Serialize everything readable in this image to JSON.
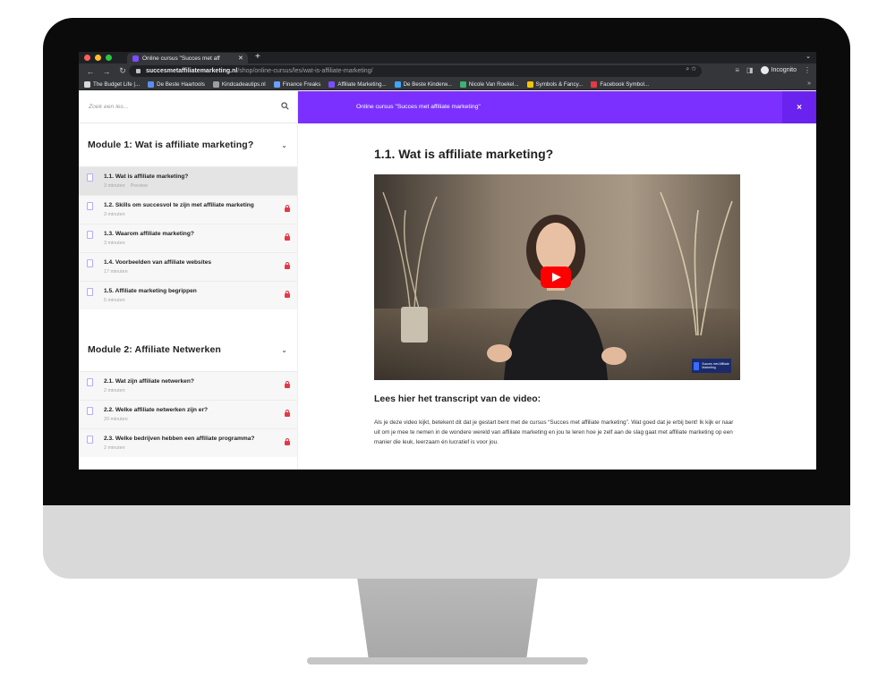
{
  "browser": {
    "tab_title": "Online cursus \"Succes met aff",
    "url_host": "succesmetaffiliatemarketing.nl",
    "url_path": "/shop/online-cursus/les/wat-is-affiliate-marketing/",
    "incognito_label": "Incognito",
    "bookmarks": [
      {
        "label": "The Budget Life |...",
        "color": "#d9d9d9"
      },
      {
        "label": "De Beste Haartools",
        "color": "#5b8def"
      },
      {
        "label": "Kindcadeautips.nl",
        "color": "#9aa0a6"
      },
      {
        "label": "Finance Freaks",
        "color": "#6aa0ff"
      },
      {
        "label": "Affiliate Marketing...",
        "color": "#7b4dff"
      },
      {
        "label": "De Beste Kinderw...",
        "color": "#3ea6ff"
      },
      {
        "label": "Nicole Van Roekel...",
        "color": "#3cb371"
      },
      {
        "label": "Symbols & Fancy...",
        "color": "#f5c400"
      },
      {
        "label": "Facebook Symbol...",
        "color": "#e53945"
      }
    ]
  },
  "sidebar": {
    "search_placeholder": "Zoek een les...",
    "modules": [
      {
        "title": "Module 1: Wat is affiliate marketing?",
        "lessons": [
          {
            "title": "1.1. Wat is affiliate marketing?",
            "duration": "3 minuten",
            "preview": "Preview",
            "locked": false,
            "active": true
          },
          {
            "title": "1.2. Skills om succesvol te zijn met affiliate marketing",
            "duration": "3 minuten",
            "preview": "",
            "locked": true,
            "active": false
          },
          {
            "title": "1.3. Waarom affiliate marketing?",
            "duration": "3 minuten",
            "preview": "",
            "locked": true,
            "active": false
          },
          {
            "title": "1.4. Voorbeelden van affiliate websites",
            "duration": "17 minuten",
            "preview": "",
            "locked": true,
            "active": false
          },
          {
            "title": "1.5. Affiliate marketing begrippen",
            "duration": "5 minuten",
            "preview": "",
            "locked": true,
            "active": false
          }
        ]
      },
      {
        "title": "Module 2: Affiliate Netwerken",
        "lessons": [
          {
            "title": "2.1. Wat zijn affiliate netwerken?",
            "duration": "2 minuten",
            "preview": "",
            "locked": true,
            "active": false
          },
          {
            "title": "2.2. Welke affiliate netwerken zijn er?",
            "duration": "20 minuten",
            "preview": "",
            "locked": true,
            "active": false
          },
          {
            "title": "2.3. Welke bedrijven hebben een affiliate programma?",
            "duration": "2 minuten",
            "preview": "",
            "locked": true,
            "active": false
          }
        ]
      }
    ]
  },
  "course_bar": {
    "title": "Online cursus \"Succes met affiliate marketing\"",
    "close_label": "×"
  },
  "content": {
    "lesson_title": "1.1. Wat is affiliate marketing?",
    "video_logo": "Succes met Affiliate Marketing",
    "transcript_heading": "Lees hier het transcript van de video:",
    "transcript_text": "Als je deze video kijkt, betekent dit dat je gestart bent met de cursus “Succes met affiliate marketing”. Wat goed dat je erbij bent! Ik kijk er naar uit om je mee te nemen in de wondere wereld van affiliate marketing en jou te leren hoe je zelf aan de slag gaat met affiliate marketing op een manier die leuk, leerzaam én lucratief is voor jou."
  }
}
